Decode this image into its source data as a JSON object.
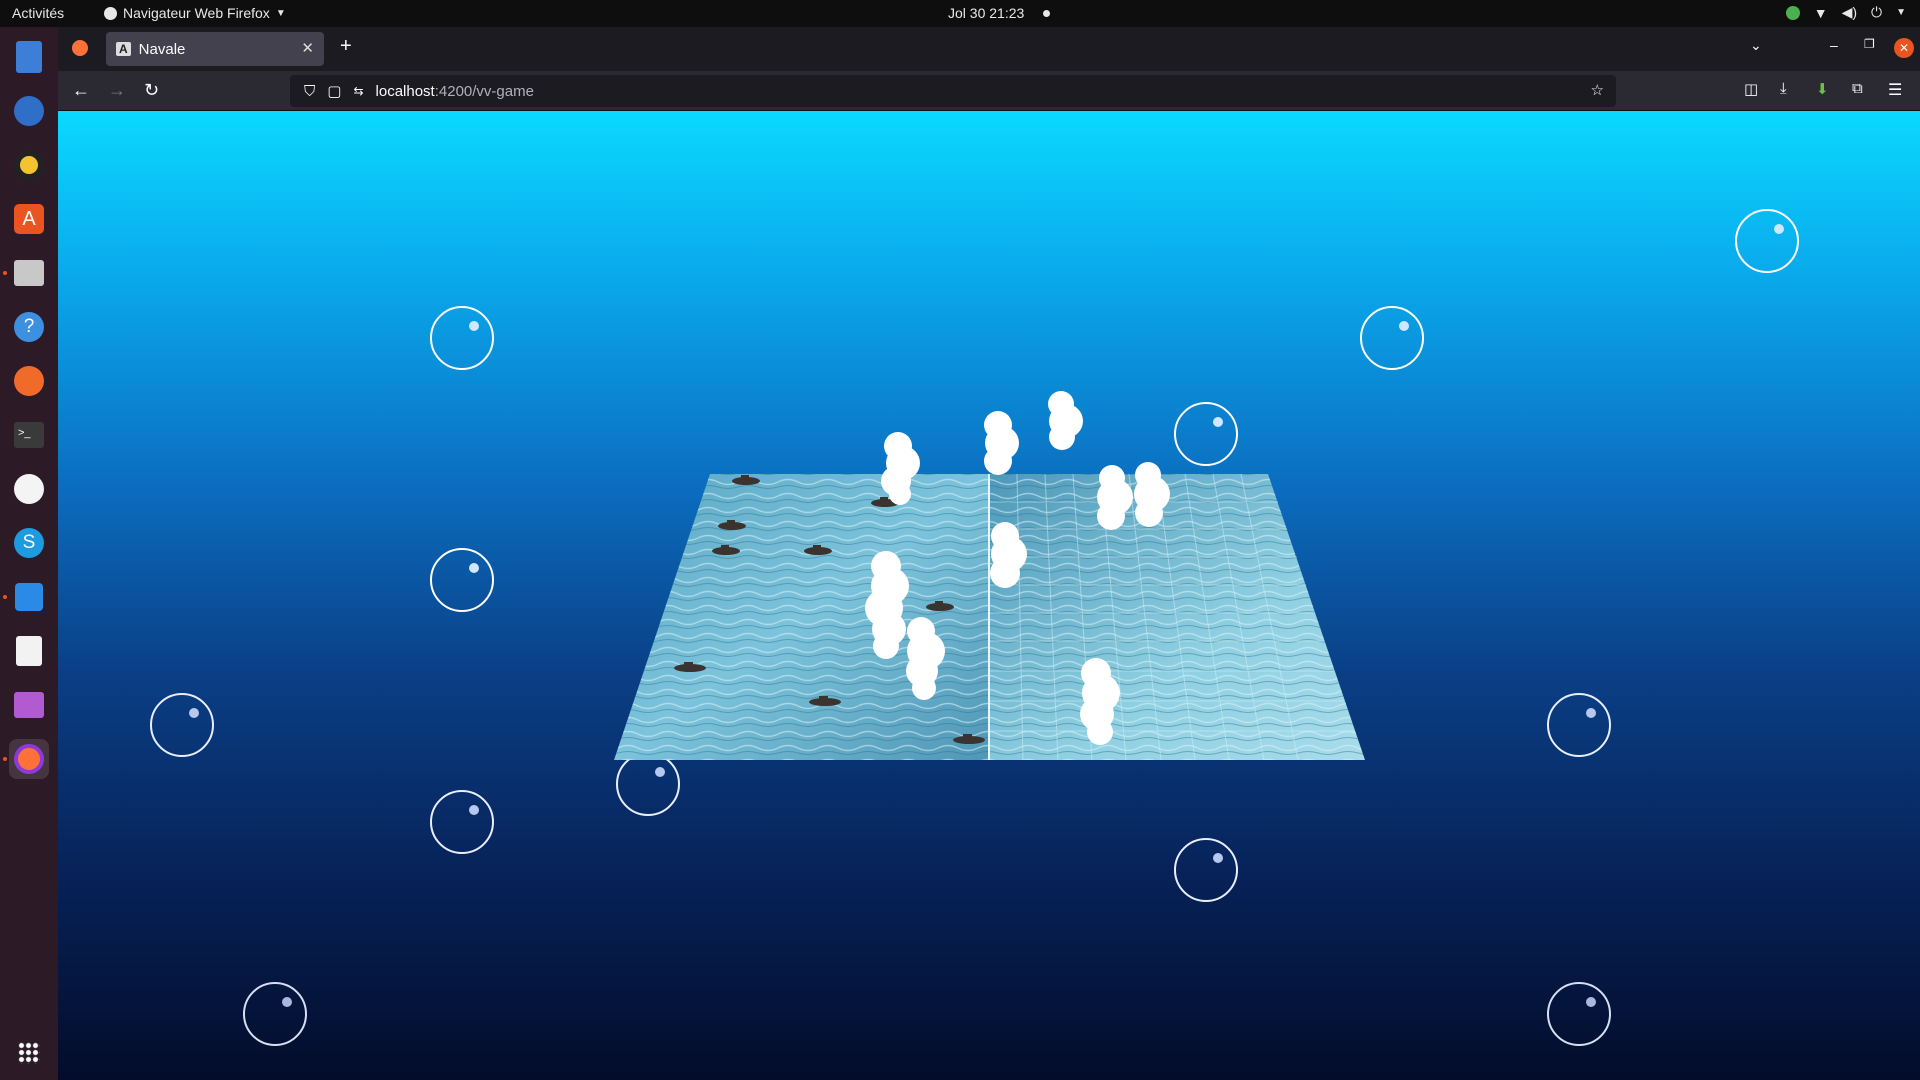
{
  "topbar": {
    "activities": "Activités",
    "app_name": "Navigateur Web Firefox",
    "clock": "Jol 30  21:23"
  },
  "browser": {
    "tab_title": "Navale",
    "url_host": "localhost",
    "url_path": ":4200/vv-game"
  },
  "dock": {
    "items": [
      "text-editor-icon",
      "mail-icon",
      "music-icon",
      "software-center-icon",
      "files-icon",
      "help-icon",
      "drawing-icon",
      "terminal-icon",
      "mongodb-icon",
      "skype-icon",
      "vscode-icon",
      "document-viewer-icon",
      "video-player-icon",
      "firefox-icon",
      "app-grid-icon"
    ]
  },
  "colors": {
    "sky_top": "#0ad9ff",
    "sky_bottom": "#030c2a",
    "water": "#7ec4d8",
    "smoke": "#ffffff"
  }
}
